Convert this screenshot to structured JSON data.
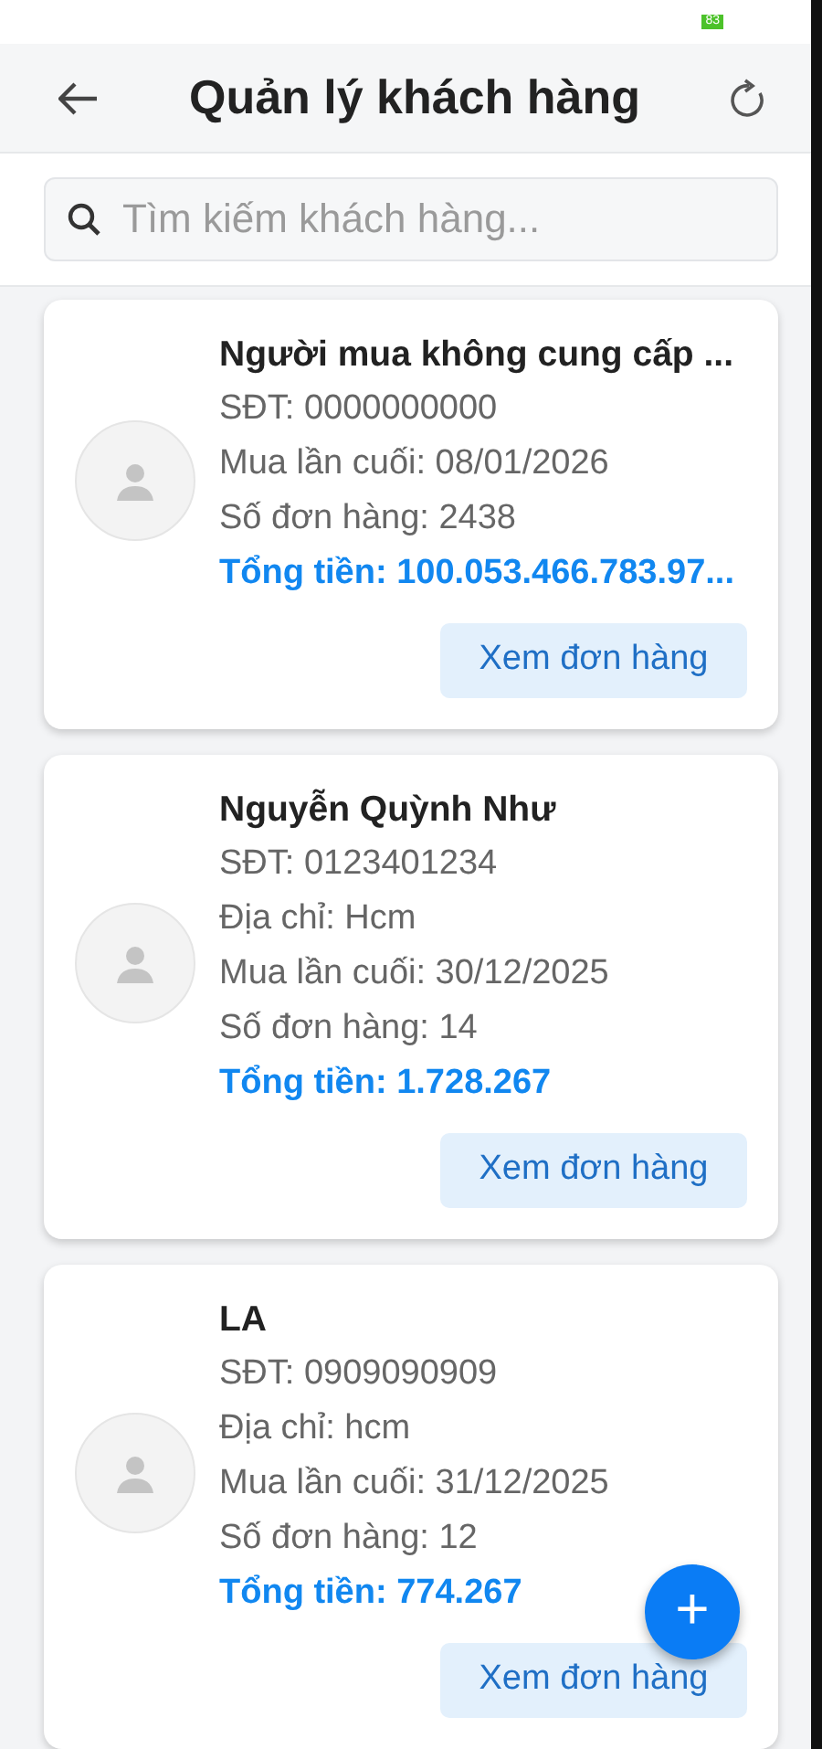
{
  "status_bar": {
    "battery": "83"
  },
  "header": {
    "title": "Quản lý khách hàng"
  },
  "search": {
    "placeholder": "Tìm kiếm khách hàng..."
  },
  "customers": [
    {
      "name": "Người mua không cung cấp ...",
      "lines": [
        "SĐT: 0000000000",
        "Mua lần cuối: 08/01/2026",
        "Số đơn hàng: 2438"
      ],
      "total": "Tổng tiền: 100.053.466.783.97...",
      "button": "Xem đơn hàng"
    },
    {
      "name": "Nguyễn Quỳnh Như",
      "lines": [
        "SĐT: 0123401234",
        "Địa chỉ: Hcm",
        "Mua lần cuối: 30/12/2025",
        "Số đơn hàng: 14"
      ],
      "total": "Tổng tiền: 1.728.267",
      "button": "Xem đơn hàng"
    },
    {
      "name": "LA",
      "lines": [
        "SĐT: 0909090909",
        "Địa chỉ: hcm",
        "Mua lần cuối: 31/12/2025",
        "Số đơn hàng: 12"
      ],
      "total": "Tổng tiền: 774.267",
      "button": "Xem đơn hàng"
    }
  ],
  "fab": {
    "label": "+"
  }
}
